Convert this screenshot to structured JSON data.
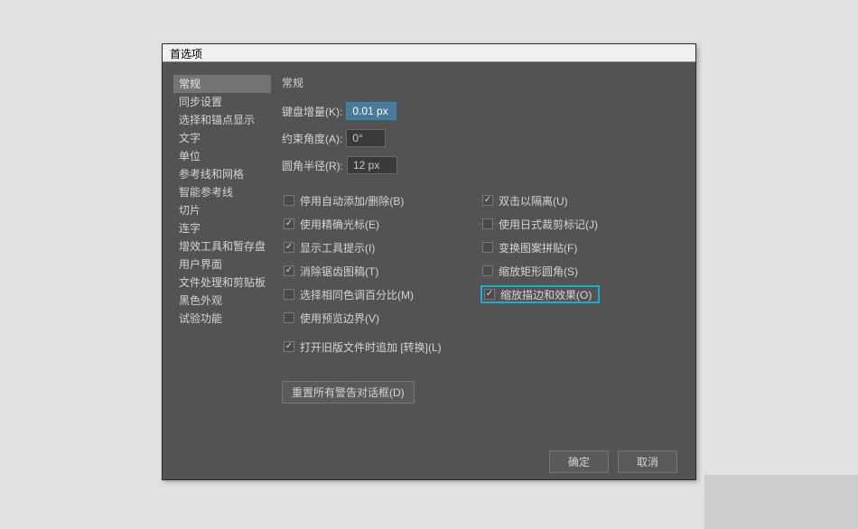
{
  "dialog": {
    "title": "首选项"
  },
  "sidebar": {
    "items": [
      {
        "label": "常规",
        "selected": true
      },
      {
        "label": "同步设置",
        "selected": false
      },
      {
        "label": "选择和锚点显示",
        "selected": false
      },
      {
        "label": "文字",
        "selected": false
      },
      {
        "label": "单位",
        "selected": false
      },
      {
        "label": "参考线和网格",
        "selected": false
      },
      {
        "label": "智能参考线",
        "selected": false
      },
      {
        "label": "切片",
        "selected": false
      },
      {
        "label": "连字",
        "selected": false
      },
      {
        "label": "增效工具和暂存盘",
        "selected": false
      },
      {
        "label": "用户界面",
        "selected": false
      },
      {
        "label": "文件处理和剪贴板",
        "selected": false
      },
      {
        "label": "黑色外观",
        "selected": false
      },
      {
        "label": "试验功能",
        "selected": false
      }
    ]
  },
  "panel": {
    "title": "常规",
    "fields": {
      "keyboard_increment": {
        "label": "键盘增量(K):",
        "value": "0.01 px",
        "highlighted": true
      },
      "constrain_angle": {
        "label": "约束角度(A):",
        "value": "0°",
        "highlighted": false
      },
      "corner_radius": {
        "label": "圆角半径(R):",
        "value": "12 px",
        "highlighted": false
      }
    },
    "checkboxes_left": [
      {
        "label": "停用自动添加/删除(B)",
        "checked": false
      },
      {
        "label": "使用精确光标(E)",
        "checked": true
      },
      {
        "label": "显示工具提示(I)",
        "checked": true
      },
      {
        "label": "消除锯齿图稿(T)",
        "checked": true
      },
      {
        "label": "选择相同色调百分比(M)",
        "checked": false
      },
      {
        "label": "使用预览边界(V)",
        "checked": false
      }
    ],
    "checkboxes_right": [
      {
        "label": "双击以隔离(U)",
        "checked": true
      },
      {
        "label": "使用日式裁剪标记(J)",
        "checked": false
      },
      {
        "label": "变换图案拼贴(F)",
        "checked": false
      },
      {
        "label": "缩放矩形圆角(S)",
        "checked": false
      },
      {
        "label": "缩放描边和效果(O)",
        "checked": true,
        "highlighted": true
      }
    ],
    "checkbox_last": {
      "label": "打开旧版文件时追加 [转换](L)",
      "checked": true
    },
    "reset_button": "重置所有警告对话框(D)"
  },
  "footer": {
    "ok": "确定",
    "cancel": "取消"
  }
}
